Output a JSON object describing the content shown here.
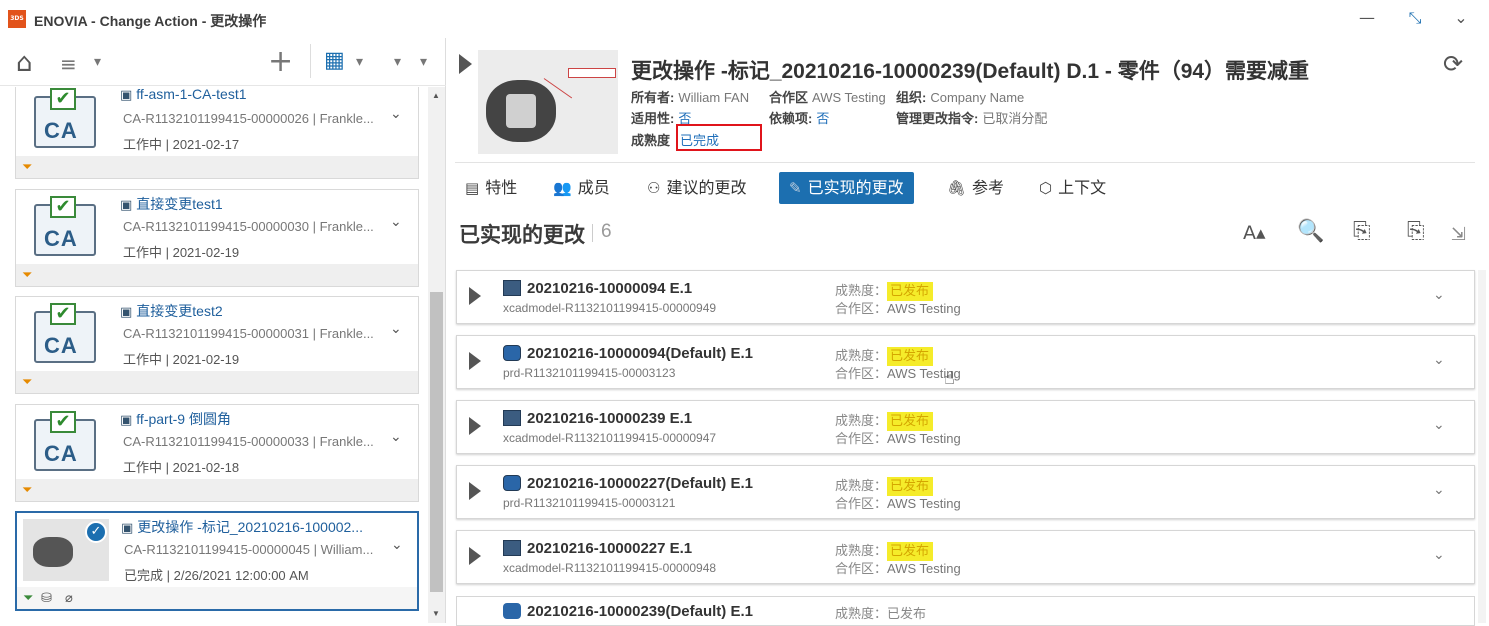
{
  "app": {
    "title": "ENOVIA - Change Action - 更改操作",
    "logo": "3DS"
  },
  "window_controls": {
    "minimize": "—",
    "restore": "⤡",
    "expand": "⌄"
  },
  "left_toolbar": {
    "home": "⌂",
    "filter": "≡",
    "add": "+",
    "view": "▦",
    "sort": "▾"
  },
  "change_actions": [
    {
      "title": "ff-asm-1-CA-test1",
      "sub": "CA-R1132101199415-00000026 | Frankle...",
      "status": "工作中 | 2021-02-17",
      "icon": "ca-document-icon"
    },
    {
      "title": "直接变更test1",
      "sub": "CA-R1132101199415-00000030 | Frankle...",
      "status": "工作中 | 2021-02-19",
      "icon": "ca-document-icon"
    },
    {
      "title": "直接变更test2",
      "sub": "CA-R1132101199415-00000031 | Frankle...",
      "status": "工作中 | 2021-02-19",
      "icon": "ca-document-icon"
    },
    {
      "title": "ff-part-9 倒圆角",
      "sub": "CA-R1132101199415-00000033 | Frankle...",
      "status": "工作中 | 2021-02-18",
      "icon": "ca-document-icon"
    },
    {
      "title": "更改操作 -标记_20210216-100002...",
      "sub": "CA-R1132101199415-00000045 | William...",
      "status": "已完成 | 2/26/2021 12:00:00 AM",
      "icon": "part-thumbnail"
    }
  ],
  "header": {
    "title": "更改操作 -标记_20210216-10000239(Default) D.1 - 零件（94）需要减重",
    "owner_label": "所有者:",
    "owner": "William FAN",
    "collab_label": "合作区",
    "collab": "AWS Testing",
    "org_label": "组织:",
    "org": "Company Name",
    "applicability_label": "适用性:",
    "applicability": "否",
    "dependency_label": "依赖项:",
    "dependency": "否",
    "governing_label": "管理更改指令:",
    "governing": "已取消分配",
    "maturity_label": "成熟度",
    "maturity": "已完成",
    "refresh": "⟳"
  },
  "tabs": [
    {
      "label": "特性",
      "icon": "▤"
    },
    {
      "label": "成员",
      "icon": "👥"
    },
    {
      "label": "建议的更改",
      "icon": "⚇"
    },
    {
      "label": "已实现的更改",
      "icon": "✎"
    },
    {
      "label": "参考",
      "icon": "🖇"
    },
    {
      "label": "上下文",
      "icon": "⬡"
    }
  ],
  "section": {
    "title": "已实现的更改",
    "count": "6"
  },
  "actions": {
    "font": "A▴",
    "search": "🔍",
    "assign": "⎘",
    "unassign": "⎘",
    "select": "⇲"
  },
  "row_labels": {
    "maturity": "成熟度：",
    "collab": "合作区："
  },
  "realized": [
    {
      "name": "20210216-10000094 E.1",
      "id": "xcadmodel-R1132101199415-00000949",
      "maturity": "已发布",
      "collab": "AWS Testing",
      "type": "cad"
    },
    {
      "name": "20210216-10000094(Default) E.1",
      "id": "prd-R1132101199415-00003123",
      "maturity": "已发布",
      "collab": "AWS Testing",
      "type": "product"
    },
    {
      "name": "20210216-10000239 E.1",
      "id": "xcadmodel-R1132101199415-00000947",
      "maturity": "已发布",
      "collab": "AWS Testing",
      "type": "cad"
    },
    {
      "name": "20210216-10000227(Default) E.1",
      "id": "prd-R1132101199415-00003121",
      "maturity": "已发布",
      "collab": "AWS Testing",
      "type": "product"
    },
    {
      "name": "20210216-10000227 E.1",
      "id": "xcadmodel-R1132101199415-00000948",
      "maturity": "已发布",
      "collab": "AWS Testing",
      "type": "cad"
    }
  ],
  "partial_row": {
    "name": "20210216-10000239(Default) E.1",
    "maturity": "成熟度：已发布"
  },
  "colors": {
    "accent": "#1c6fb0",
    "highlight": "#f5ec2a",
    "highlight_border": "#e0141b"
  }
}
